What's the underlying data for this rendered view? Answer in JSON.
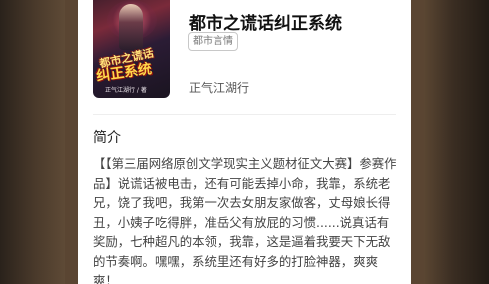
{
  "book": {
    "title": "都市之谎话纠正系统",
    "tag": "都市言情",
    "author": "正气江湖行",
    "cover": {
      "title_line1": "都市之谎话",
      "title_line2": "纠正系统",
      "author": "正气江湖行 / 著"
    }
  },
  "intro": {
    "heading": "简介",
    "text": "【【第三届网络原创文学现实主义题材征文大赛】参赛作品】说谎话被电击，还有可能丢掉小命，我靠，系统老兄，饶了我吧，我第一次去女朋友家做客，丈母娘长得丑，小姨子吃得胖，准岳父有放屁的习惯......说真话有奖励，七种超凡的本领，我靠，这是逼着我要天下无敌的节奏啊。嘿嘿，系统里还有好多的打脸神器，爽爽爽！"
  },
  "colors": {
    "background": "#5a4532",
    "card": "#ffffff",
    "title_text": "#111111",
    "body_text": "#444444"
  }
}
